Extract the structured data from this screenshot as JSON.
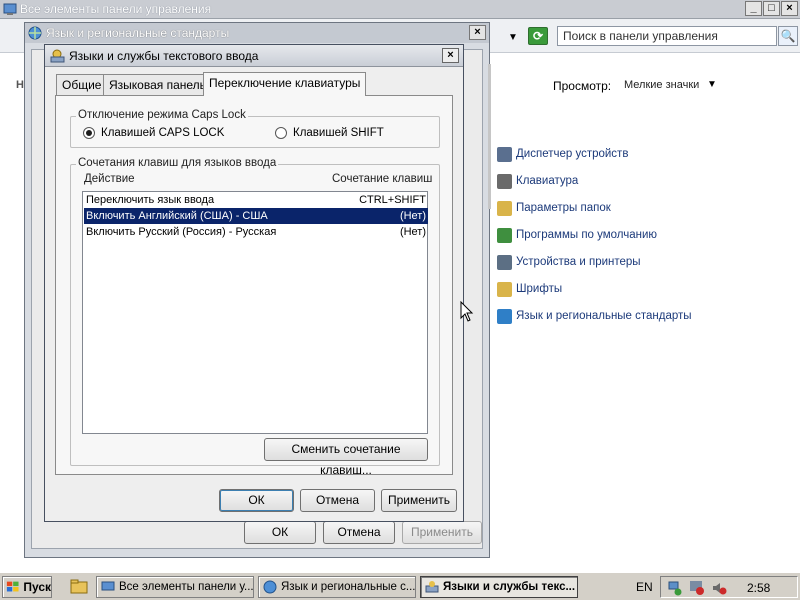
{
  "control_panel": {
    "title": "Все элементы панели управления",
    "search_placeholder": "Поиск в панели управления",
    "view_label": "Просмотр:",
    "view_value": "Мелкие значки",
    "items": [
      {
        "label": "Диспетчер устройств",
        "icon": "device-manager-icon",
        "color": "#5a6f8f"
      },
      {
        "label": "Клавиатура",
        "icon": "keyboard-icon",
        "color": "#6a6a6a"
      },
      {
        "label": "Параметры папок",
        "icon": "folder-options-icon",
        "color": "#d9b44a"
      },
      {
        "label": "Программы по умолчанию",
        "icon": "default-programs-icon",
        "color": "#3f8f3f"
      },
      {
        "label": "Устройства и принтеры",
        "icon": "printer-icon",
        "color": "#5c6f84"
      },
      {
        "label": "Шрифты",
        "icon": "fonts-folder-icon",
        "color": "#d9b44a"
      },
      {
        "label": "Язык и региональные стандарты",
        "icon": "globe-icon",
        "color": "#2f7fc7"
      }
    ]
  },
  "regional_window": {
    "title": "Язык и региональные стандарты",
    "buttons": {
      "ok": "ОК",
      "cancel": "Отмена",
      "apply": "Применить"
    }
  },
  "text_services": {
    "title": "Языки и службы текстового ввода",
    "tabs": [
      "Общие",
      "Языковая панель",
      "Переключение клавиатуры"
    ],
    "capslock": {
      "legend": "Отключение режима Caps Lock",
      "option1": "Клавишей CAPS LOCK",
      "option2": "Клавишей SHIFT"
    },
    "hotkeys": {
      "legend": "Сочетания клавиш для языков ввода",
      "col_action": "Действие",
      "col_keys": "Сочетание клавиш",
      "rows": [
        {
          "action": "Переключить язык ввода",
          "keys": "CTRL+SHIFT"
        },
        {
          "action": "Включить Английский (США) - США",
          "keys": "(Нет)"
        },
        {
          "action": "Включить Русский (Россия) - Русская",
          "keys": "(Нет)"
        }
      ],
      "change_button": "Сменить сочетание клавиш..."
    },
    "buttons": {
      "ok": "ОК",
      "cancel": "Отмена",
      "apply": "Применить"
    }
  },
  "taskbar": {
    "start_label": "Пуск",
    "tasks": [
      "Все элементы панели у...",
      "Язык и региональные с...",
      "Языки и службы текс..."
    ],
    "lang": "EN",
    "time": "2:58"
  }
}
